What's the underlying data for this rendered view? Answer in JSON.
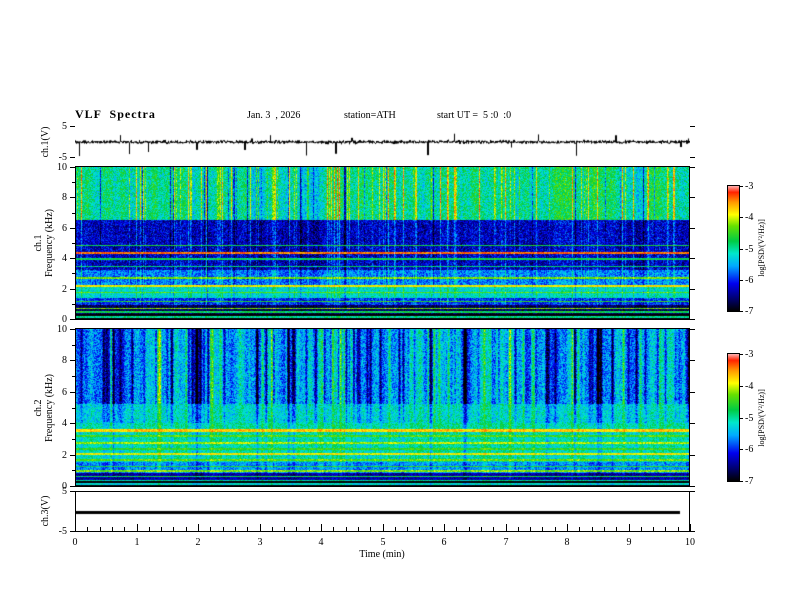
{
  "header": {
    "title": "VLF  Spectra",
    "date": "Jan. 3  , 2026",
    "station": "station=ATH",
    "start_ut": "start UT =  5 :0  :0"
  },
  "xaxis": {
    "label": "Time  (min)",
    "min": 0,
    "max": 10,
    "ticks": [
      0,
      1,
      2,
      3,
      4,
      5,
      6,
      7,
      8,
      9,
      10
    ],
    "minor_step": 0.2
  },
  "panels": {
    "ch1v": {
      "ylabel": "ch.1(V)",
      "ymin": -5,
      "ymax": 5,
      "yticks": [
        5,
        -5
      ]
    },
    "ch1spec": {
      "channel": "ch.1",
      "ylabel": "Frequency  (kHz)",
      "ymin": 0,
      "ymax": 10,
      "yticks": [
        10,
        8,
        6,
        4,
        2,
        0
      ]
    },
    "ch2spec": {
      "channel": "ch.2",
      "ylabel": "Frequency  (kHz)",
      "ymin": 0,
      "ymax": 10,
      "yticks": [
        10,
        8,
        6,
        4,
        2,
        0
      ]
    },
    "ch3v": {
      "ylabel": "ch.3(V)",
      "ymin": -5,
      "ymax": 5,
      "yticks": [
        5,
        -5
      ]
    }
  },
  "colorbar": {
    "label": "log[PSD/(V²/Hz)]",
    "ticks": [
      -3,
      -4,
      -5,
      -6,
      -7
    ],
    "min": -7,
    "max": -3,
    "stops": [
      {
        "pos": 0.0,
        "color": "#000000"
      },
      {
        "pos": 0.09,
        "color": "#000066"
      },
      {
        "pos": 0.22,
        "color": "#0000ee"
      },
      {
        "pos": 0.36,
        "color": "#00aaff"
      },
      {
        "pos": 0.46,
        "color": "#00e8cc"
      },
      {
        "pos": 0.56,
        "color": "#00cc44"
      },
      {
        "pos": 0.68,
        "color": "#66e000"
      },
      {
        "pos": 0.77,
        "color": "#ffff00"
      },
      {
        "pos": 0.87,
        "color": "#ff9900"
      },
      {
        "pos": 0.95,
        "color": "#ff2200"
      },
      {
        "pos": 1.0,
        "color": "#ffb3b3"
      }
    ]
  },
  "chart_data": [
    {
      "type": "line",
      "panel": "ch.1(V) waveform",
      "xlim": [
        0,
        10
      ],
      "ylim": [
        -5,
        5
      ],
      "description": "Dense black broadband noise trace centered on 0 V, typical excursions about ±1 V, with intermittent impulsive spikes reaching about -4.5 V downward and +3 V upward across the full 10 minutes."
    },
    {
      "type": "heatmap",
      "panel": "ch.1 spectrogram",
      "xlim": [
        0,
        10
      ],
      "ylim": [
        0,
        10
      ],
      "zlabel": "log[PSD/(V²/Hz)]",
      "zlim": [
        -7,
        -3
      ],
      "bright_streak_prob": 0.16,
      "dark_streak_prob": 0.06,
      "streak_smooth": 0,
      "bands": [
        {
          "f": [
            6.5,
            10.0
          ],
          "psd": -5.0,
          "noise": 0.45,
          "streak": 0.9
        },
        {
          "f": [
            3.2,
            6.5
          ],
          "psd": -6.3,
          "noise": 0.45,
          "streak": 0.4
        },
        {
          "f": [
            2.2,
            3.2
          ],
          "psd": -5.7,
          "noise": 0.4,
          "streak": 0.35
        },
        {
          "f": [
            1.4,
            2.2
          ],
          "psd": -5.2,
          "noise": 0.35,
          "streak": 0.3
        },
        {
          "f": [
            0.9,
            1.4
          ],
          "psd": -6.0,
          "noise": 0.4,
          "streak": 0.25
        },
        {
          "f": [
            0.35,
            0.9
          ],
          "psd": -6.7,
          "noise": 0.3,
          "streak": 0.15
        },
        {
          "f": [
            0.0,
            0.35
          ],
          "psd": -7.0,
          "noise": 0.1,
          "streak": 0.0
        }
      ],
      "lines": [
        {
          "f": 4.85,
          "psd": -4.7
        },
        {
          "f": 4.35,
          "psd": -3.4,
          "w": 0.06
        },
        {
          "f": 3.95,
          "psd": -4.8
        },
        {
          "f": 3.45,
          "psd": -4.9
        },
        {
          "f": 2.7,
          "psd": -4.3
        },
        {
          "f": 2.15,
          "psd": -3.9,
          "w": 0.06
        },
        {
          "f": 1.75,
          "psd": -4.4
        },
        {
          "f": 1.15,
          "psd": -4.6
        },
        {
          "f": 0.7,
          "psd": -4.3
        },
        {
          "f": 0.45,
          "psd": -4.8
        },
        {
          "f": 0.12,
          "psd": -5.0
        }
      ]
    },
    {
      "type": "heatmap",
      "panel": "ch.2 spectrogram",
      "xlim": [
        0,
        10
      ],
      "ylim": [
        0,
        10
      ],
      "zlabel": "log[PSD/(V²/Hz)]",
      "zlim": [
        -7,
        -3
      ],
      "bright_streak_prob": 0.07,
      "dark_streak_prob": 0.17,
      "streak_smooth": 1,
      "bands": [
        {
          "f": [
            5.2,
            10.0
          ],
          "psd": -5.5,
          "noise": 0.45,
          "streak": 0.95
        },
        {
          "f": [
            4.0,
            5.2
          ],
          "psd": -5.2,
          "noise": 0.4,
          "streak": 0.5
        },
        {
          "f": [
            3.3,
            4.0
          ],
          "psd": -5.0,
          "noise": 0.35,
          "streak": 0.35
        },
        {
          "f": [
            1.5,
            3.3
          ],
          "psd": -5.05,
          "noise": 0.3,
          "streak": 0.3
        },
        {
          "f": [
            0.8,
            1.5
          ],
          "psd": -5.6,
          "noise": 0.35,
          "streak": 0.25
        },
        {
          "f": [
            0.3,
            0.8
          ],
          "psd": -6.4,
          "noise": 0.3,
          "streak": 0.15
        },
        {
          "f": [
            0.0,
            0.3
          ],
          "psd": -7.0,
          "noise": 0.1,
          "streak": 0.0
        }
      ],
      "lines": [
        {
          "f": 3.55,
          "psd": -3.7,
          "w": 0.08
        },
        {
          "f": 3.2,
          "psd": -4.4
        },
        {
          "f": 2.75,
          "psd": -4.1
        },
        {
          "f": 2.35,
          "psd": -4.5
        },
        {
          "f": 2.05,
          "psd": -3.9,
          "w": 0.07
        },
        {
          "f": 1.65,
          "psd": -4.3
        },
        {
          "f": 1.25,
          "psd": -4.6
        },
        {
          "f": 0.95,
          "psd": -4.2
        },
        {
          "f": 0.6,
          "psd": -4.7
        },
        {
          "f": 0.35,
          "psd": -5.0
        },
        {
          "f": 0.12,
          "psd": -5.2
        }
      ]
    },
    {
      "type": "line",
      "panel": "ch.3(V) waveform",
      "xlim": [
        0,
        10
      ],
      "ylim": [
        -5,
        5
      ],
      "constant_value": 0,
      "description": "Flat thick black line at 0 V (no signal) extending from t=0 to about t=9.85 min."
    }
  ]
}
